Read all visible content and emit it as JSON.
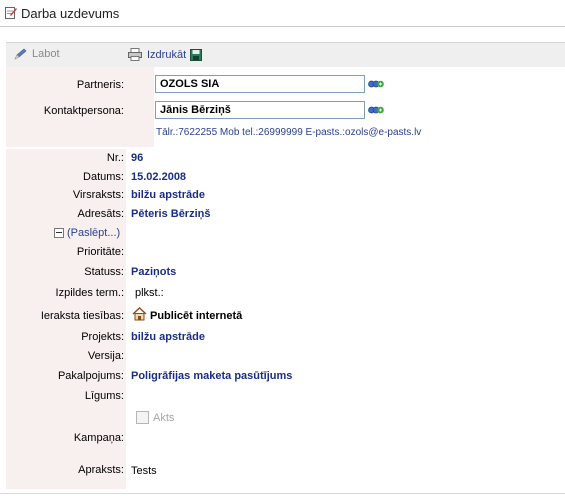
{
  "header": {
    "title": "Darba uzdevums",
    "icon": "edit-document-icon"
  },
  "toolbar": {
    "edit_label": "Labot",
    "print_label": "Izdrukāt"
  },
  "partner": {
    "label": "Partneris:",
    "value": "OZOLS SIA",
    "contact_label": "Kontaktpersona:",
    "contact_value": "Jānis Bērziņš",
    "contacts_line": "Tālr.:7622255 Mob tel.:26999999 E-pasts.:ozols@e-pasts.lv"
  },
  "fields": {
    "nr_label": "Nr.:",
    "nr": "96",
    "date_label": "Datums:",
    "date": "15.02.2008",
    "subject_label": "Virsraksts:",
    "subject": "bilžu apstrāde",
    "addressee_label": "Adresāts:",
    "addressee": "Pēteris Bērziņš",
    "toggle_label": "(Paslēpt...)",
    "priority_label": "Prioritāte:",
    "priority": "",
    "status_label": "Statuss:",
    "status": "Paziņots",
    "due_label": "Izpildes term.:",
    "due": "plkst.:",
    "access_label": "Ieraksta tiesības:",
    "access": "Publicēt internetā",
    "project_label": "Projekts:",
    "project": "bilžu apstrāde",
    "version_label": "Versija:",
    "version": "",
    "service_label": "Pakalpojums:",
    "service": "Poligrāfijas maketa pasūtījums",
    "contract_label": "Līgums:",
    "contract": "",
    "akts_label": "Akts",
    "campaign_label": "Kampaņa:",
    "campaign": "",
    "description_label": "Apraksts:",
    "description": "Tests"
  },
  "colors": {
    "label_bg": "#f7f0ef",
    "link": "#1a2d84",
    "toolbar_bg": "#efefef"
  }
}
